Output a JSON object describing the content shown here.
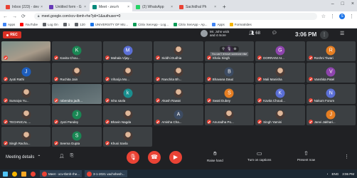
{
  "browser": {
    "tabs": [
      {
        "label": "Inbox (223) - dev",
        "color": "#ea4335",
        "active": false
      },
      {
        "label": "Untitled form - G",
        "color": "#673ab7",
        "active": false
      },
      {
        "label": "Meet - zeu-h",
        "color": "#00897b",
        "active": true
      },
      {
        "label": "(2) WhatsApp",
        "color": "#25d366",
        "active": false
      },
      {
        "label": "Sachidhal Ph",
        "color": "#ea4335",
        "active": false
      }
    ],
    "new_tab": "+",
    "url": "meet.google.com/xcv-tbmh-rhe?pli=1&authuser=0",
    "bookmarks": [
      {
        "label": "Apps",
        "color": "#4285f4"
      },
      {
        "label": "YouTube",
        "color": "#ff0000"
      },
      {
        "label": "Log On",
        "color": "#5f6368"
      },
      {
        "label": "1",
        "color": "#5f6368"
      },
      {
        "label": "120",
        "color": "#5f6368"
      },
      {
        "label": "UNIVERSITY OF MU...",
        "color": "#1a73e8"
      },
      {
        "label": "Citrix XenApp - Log...",
        "color": "#0f9d58"
      },
      {
        "label": "Citrix XenApp - Ap...",
        "color": "#0f9d58"
      },
      {
        "label": "Apps",
        "color": "#4285f4"
      },
      {
        "label": "Formatrides",
        "color": "#f4b400"
      }
    ],
    "profile_initial": "S"
  },
  "meet": {
    "rec_label": "REC",
    "pinned_text_line1": "Mr. John wick",
    "pinned_text_line2": "and 4 more",
    "participants_count": "68",
    "time": "3:06 PM",
    "tiles": [
      {
        "name": "",
        "initial": "",
        "kind": "cam",
        "color": "#5f6368"
      },
      {
        "name": "Kavita Chou...",
        "initial": "K",
        "kind": "letter",
        "color": "#1a8754"
      },
      {
        "name": "Mahala Vijay...",
        "initial": "M",
        "kind": "letter",
        "color": "#5b6fd6"
      },
      {
        "name": "Siddhi Dudhia",
        "initial": "",
        "kind": "photo",
        "color": "#5f6368"
      },
      {
        "name": "Shalu Singh",
        "initial": "S",
        "kind": "letter",
        "color": "#8e44ad",
        "hover": true
      },
      {
        "name": "DORRANI AI...",
        "initial": "G",
        "kind": "letter",
        "color": "#8e44ad"
      },
      {
        "name": "Roshni Tiwari",
        "initial": "R",
        "kind": "letter",
        "color": "#e67e22"
      },
      {
        "name": "Jyoti Rathi",
        "initial": "J",
        "kind": "letter",
        "color": "#1e5ebd"
      },
      {
        "name": "Ruchita Jain",
        "initial": "",
        "kind": "photo",
        "color": "#5f6368"
      },
      {
        "name": "Viharija Mo...",
        "initial": "",
        "kind": "photo",
        "color": "#5f6368"
      },
      {
        "name": "Ranchita Bh...",
        "initial": "",
        "kind": "photo",
        "color": "#5f6368"
      },
      {
        "name": "Bhavana Daud",
        "initial": "B",
        "kind": "letter",
        "color": "#3c4b62"
      },
      {
        "name": "Mali Manisha",
        "initial": "",
        "kind": "photo",
        "color": "#5f6368"
      },
      {
        "name": "Vanshita Patel",
        "initial": "V",
        "kind": "letter",
        "color": "#8e44ad"
      },
      {
        "name": "Sumaiya Yu...",
        "initial": "",
        "kind": "photo",
        "color": "#5f6368"
      },
      {
        "name": "rabendra jadh...",
        "initial": "",
        "kind": "cam2",
        "color": "#5f6368"
      },
      {
        "name": "Isha savla",
        "initial": "k",
        "kind": "letter",
        "color": "#1a8f8f"
      },
      {
        "name": "Akash Rawat",
        "initial": "",
        "kind": "photo",
        "color": "#5f6368"
      },
      {
        "name": "Swati Dubey",
        "initial": "S",
        "kind": "letter",
        "color": "#e67e22"
      },
      {
        "name": "Kavita Choud...",
        "initial": "K",
        "kind": "letter",
        "color": "#5b6fd6"
      },
      {
        "name": "Nakum Forum",
        "initial": "N",
        "kind": "letter",
        "color": "#5b6fd6"
      },
      {
        "name": "TECHNICAL ...",
        "initial": "",
        "kind": "photo",
        "color": "#5f6368"
      },
      {
        "name": "Jyoti Pandey",
        "initial": "J",
        "kind": "letter",
        "color": "#1a8754"
      },
      {
        "name": "Bhavin Nagda",
        "initial": "",
        "kind": "photo",
        "color": "#5f6368"
      },
      {
        "name": "Amisha Cha...",
        "initial": "A",
        "kind": "letter",
        "color": "#3c4b62"
      },
      {
        "name": "Anuradha Po...",
        "initial": "",
        "kind": "photo",
        "color": "#5f6368"
      },
      {
        "name": "Singh Yamini",
        "initial": "",
        "kind": "photo",
        "color": "#5f6368"
      },
      {
        "name": "Janvi Jakhari...",
        "initial": "J",
        "kind": "letter",
        "color": "#e67e22"
      },
      {
        "name": "Singh Racha...",
        "initial": "",
        "kind": "photo",
        "color": "#5f6368"
      },
      {
        "name": "Seema Gupta",
        "initial": "S",
        "kind": "letter",
        "color": "#1a8754"
      },
      {
        "name": "Khusi Savla",
        "initial": "",
        "kind": "photo",
        "color": "#5f6368"
      }
    ],
    "tooltip": "You can't remove someone else",
    "controls": {
      "meeting_details": "Meeting details",
      "raise_hand": "Raise hand",
      "captions": "Turn on captions",
      "present": "Present now"
    }
  },
  "taskbar": {
    "items": [
      {
        "label": "Meet - xcv-tbmh-rhe..."
      },
      {
        "label": "3-1-2021 vachshesh..."
      }
    ],
    "lang": "ENG",
    "time": "3:06 PM"
  }
}
